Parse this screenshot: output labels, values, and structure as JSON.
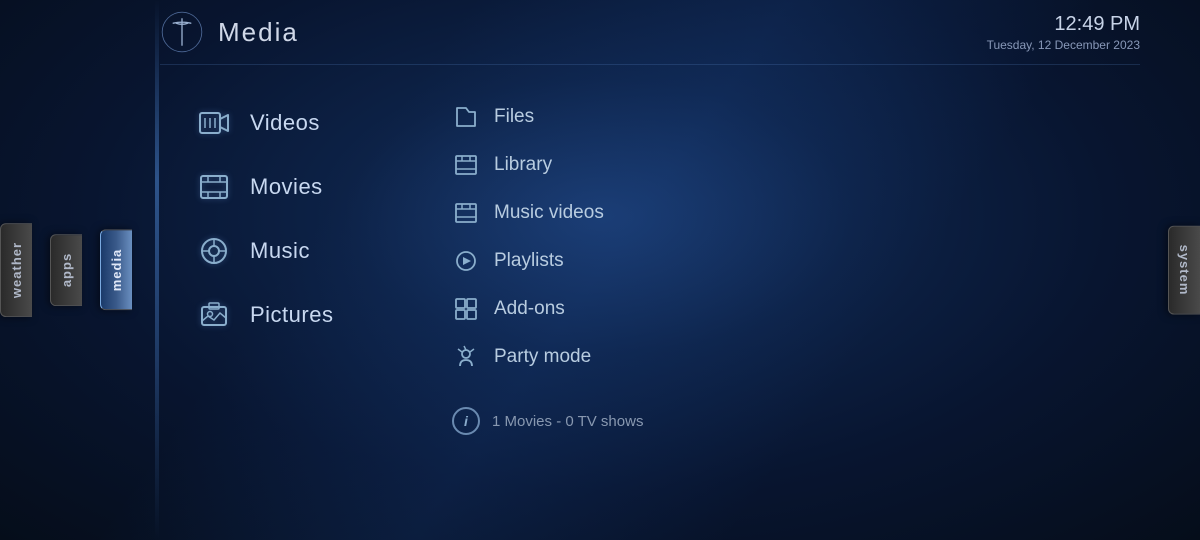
{
  "header": {
    "title": "Media",
    "time": "12:49 PM",
    "date": "Tuesday, 12 December 2023",
    "logo_alt": "Tesla logo"
  },
  "tabs": {
    "left": [
      {
        "id": "weather",
        "label": "weather"
      },
      {
        "id": "apps",
        "label": "apps"
      },
      {
        "id": "media",
        "label": "media"
      }
    ],
    "right": [
      {
        "id": "system",
        "label": "system"
      }
    ]
  },
  "left_menu": {
    "items": [
      {
        "id": "videos",
        "label": "Videos",
        "icon": "🎬"
      },
      {
        "id": "movies",
        "label": "Movies",
        "icon": "🎞"
      },
      {
        "id": "music",
        "label": "Music",
        "icon": "🎵"
      },
      {
        "id": "pictures",
        "label": "Pictures",
        "icon": "📷"
      }
    ]
  },
  "right_menu": {
    "items": [
      {
        "id": "files",
        "label": "Files",
        "icon": "📁"
      },
      {
        "id": "library",
        "label": "Library",
        "icon": "🎞"
      },
      {
        "id": "music-videos",
        "label": "Music videos",
        "icon": "🎞"
      },
      {
        "id": "playlists",
        "label": "Playlists",
        "icon": "⚙"
      },
      {
        "id": "add-ons",
        "label": "Add-ons",
        "icon": "🧩"
      },
      {
        "id": "party-mode",
        "label": "Party mode",
        "icon": "🎉"
      }
    ],
    "info": "1 Movies  -  0 TV shows"
  }
}
